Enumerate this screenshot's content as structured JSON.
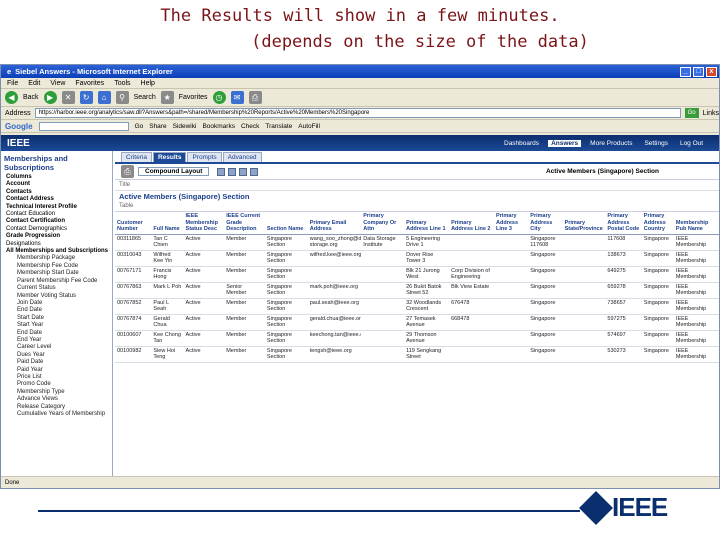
{
  "slide": {
    "title_line1": "The Results will show in a few minutes.",
    "title_line2": "(depends on the size of the data)",
    "footer_logo": "IEEE"
  },
  "window": {
    "title": "Siebel Answers - Microsoft Internet Explorer",
    "controls": [
      "_",
      "□",
      "x"
    ],
    "menu": [
      "File",
      "Edit",
      "View",
      "Favorites",
      "Tools",
      "Help"
    ],
    "toolbar": [
      "Back",
      "Search",
      "Favorites"
    ],
    "address_label": "Address",
    "address": "https://harbor.ieee.org/analytics/saw.dll?Answers&path=/shared/Membership%20Reports/Active%20Members%20Singapore",
    "go_label": "Go",
    "links_label": "Links",
    "google_label": "Google",
    "google_bar": [
      "Go",
      "Share",
      "Sidewiki",
      "Bookmarks",
      "Check",
      "Translate",
      "AutoFill"
    ],
    "status": "Done"
  },
  "app": {
    "logo": "IEEE",
    "nav": [
      "Dashboards",
      "Answers",
      "More Products",
      "Settings",
      "Log Out"
    ],
    "active_nav": "Answers"
  },
  "sidebar": {
    "title": "Memberships and Subscriptions",
    "items": [
      {
        "label": "Columns",
        "type": "bold"
      },
      {
        "label": "Account",
        "type": "bold"
      },
      {
        "label": "Contacts",
        "type": "bold"
      },
      {
        "label": "Contact Address",
        "type": "bold"
      },
      {
        "label": "Technical Interest Profile",
        "type": "bold"
      },
      {
        "label": "Contact Education",
        "type": ""
      },
      {
        "label": "Contact Certification",
        "type": "bold"
      },
      {
        "label": "Contact Demographics",
        "type": ""
      },
      {
        "label": "Grade Progression",
        "type": "bold"
      },
      {
        "label": "Designations",
        "type": ""
      },
      {
        "label": "All Memberships and Subscriptions",
        "type": "bold"
      },
      {
        "label": "Membership Package",
        "type": "sub"
      },
      {
        "label": "Membership Fee Code",
        "type": "sub"
      },
      {
        "label": "Membership Start Date",
        "type": "sub"
      },
      {
        "label": "Parent Membership Fee Code",
        "type": "sub"
      },
      {
        "label": "Current Status",
        "type": "sub"
      },
      {
        "label": "Member Voting Status",
        "type": "sub"
      },
      {
        "label": "Join Date",
        "type": "sub"
      },
      {
        "label": "End Date",
        "type": "sub"
      },
      {
        "label": "Start Date",
        "type": "sub"
      },
      {
        "label": "Start Year",
        "type": "sub"
      },
      {
        "label": "End Date",
        "type": "sub"
      },
      {
        "label": "End Year",
        "type": "sub"
      },
      {
        "label": "Career Level",
        "type": "sub"
      },
      {
        "label": "Dues Year",
        "type": "sub"
      },
      {
        "label": "Paid Date",
        "type": "sub"
      },
      {
        "label": "Paid Year",
        "type": "sub"
      },
      {
        "label": "Price List",
        "type": "sub"
      },
      {
        "label": "Promo Code",
        "type": "sub"
      },
      {
        "label": "Membership Type",
        "type": "sub"
      },
      {
        "label": "Advance Views",
        "type": "sub"
      },
      {
        "label": "Release Category",
        "type": "sub"
      },
      {
        "label": "Cumulative Years of Membership",
        "type": "sub"
      }
    ]
  },
  "main": {
    "tabs": [
      "Criteria",
      "Results",
      "Prompts",
      "Advanced"
    ],
    "active_tab": "Results",
    "layout_label": "Compound Layout",
    "section_label": "Active Members (Singapore) Section",
    "title_row": "Title",
    "table_title": "Active Members (Singapore) Section",
    "table_sub": "Table",
    "columns": [
      "Customer Number",
      "Full Name",
      "IEEE Membership Status Desc",
      "IEEE Current Grade Description",
      "Section Name",
      "Primary Email Address",
      "Primary Company Or Attn",
      "Primary Address Line 1",
      "Primary Address Line 2",
      "Primary Address Line 3",
      "Primary Address City",
      "Primary State/Province",
      "Primary Address Postal Code",
      "Primary Address Country",
      "Membership Pub Name"
    ],
    "rows": [
      [
        "00311865",
        "Tan C Chien",
        "Active",
        "Member",
        "Singapore Section",
        "wang_soo_zhong@data-storage.org",
        "Data Storage Institute",
        "5 Engineering Drive 1",
        "",
        "",
        "Singapore 117608",
        "",
        "117608",
        "Singapore",
        "IEEE Membership"
      ],
      [
        "00310043",
        "Wilfred Kee Yin",
        "Active",
        "Member",
        "Singapore Section",
        "wilfred.kee@ieee.org",
        "",
        "Dover Rise Tower 3",
        "",
        "",
        "Singapore",
        "",
        "138673",
        "Singapore",
        "IEEE Membership"
      ],
      [
        "00767171",
        "Francis Hong",
        "Active",
        "Member",
        "Singapore Section",
        "",
        "",
        "Blk 21 Jurong West",
        "Corp Division of Engineering",
        "",
        "Singapore",
        "",
        "649275",
        "Singapore",
        "IEEE Membership"
      ],
      [
        "00767863",
        "Mark L Poh",
        "Active",
        "Senior Member",
        "Singapore Section",
        "mark.poh@ieee.org",
        "",
        "26 Bukit Batok Street 52",
        "Blk View Estate",
        "",
        "Singapore",
        "",
        "659278",
        "Singapore",
        "IEEE Membership"
      ],
      [
        "00767852",
        "Paul L Seah",
        "Active",
        "Member",
        "Singapore Section",
        "paul.seah@ieee.org",
        "",
        "32 Woodlands Crescent",
        "676478",
        "",
        "Singapore",
        "",
        "738657",
        "Singapore",
        "IEEE Membership"
      ],
      [
        "00767874",
        "Gerald Chua",
        "Active",
        "Member",
        "Singapore Section",
        "gerald.chua@ieee.org",
        "",
        "27 Temasek Avenue",
        "668478",
        "",
        "Singapore",
        "",
        "597275",
        "Singapore",
        "IEEE Membership"
      ],
      [
        "00100607",
        "Kee Chong Tan",
        "Active",
        "Member",
        "Singapore Section",
        "keechong.tan@ieee.org",
        "",
        "29 Thomson Avenue",
        "",
        "",
        "Singapore",
        "",
        "574697",
        "Singapore",
        "IEEE Membership"
      ],
      [
        "00100982",
        "Siew Hoi Teng",
        "Active",
        "Member",
        "Singapore Section",
        "tengsh@ieee.org",
        "",
        "119 Sengkang Street",
        "",
        "",
        "Singapore",
        "",
        "530273",
        "Singapore",
        "IEEE Membership"
      ]
    ]
  },
  "colors": {
    "title_red": "#7a1418",
    "ieee_blue": "#0b2e6e",
    "xp_title": "#2d62d6"
  }
}
